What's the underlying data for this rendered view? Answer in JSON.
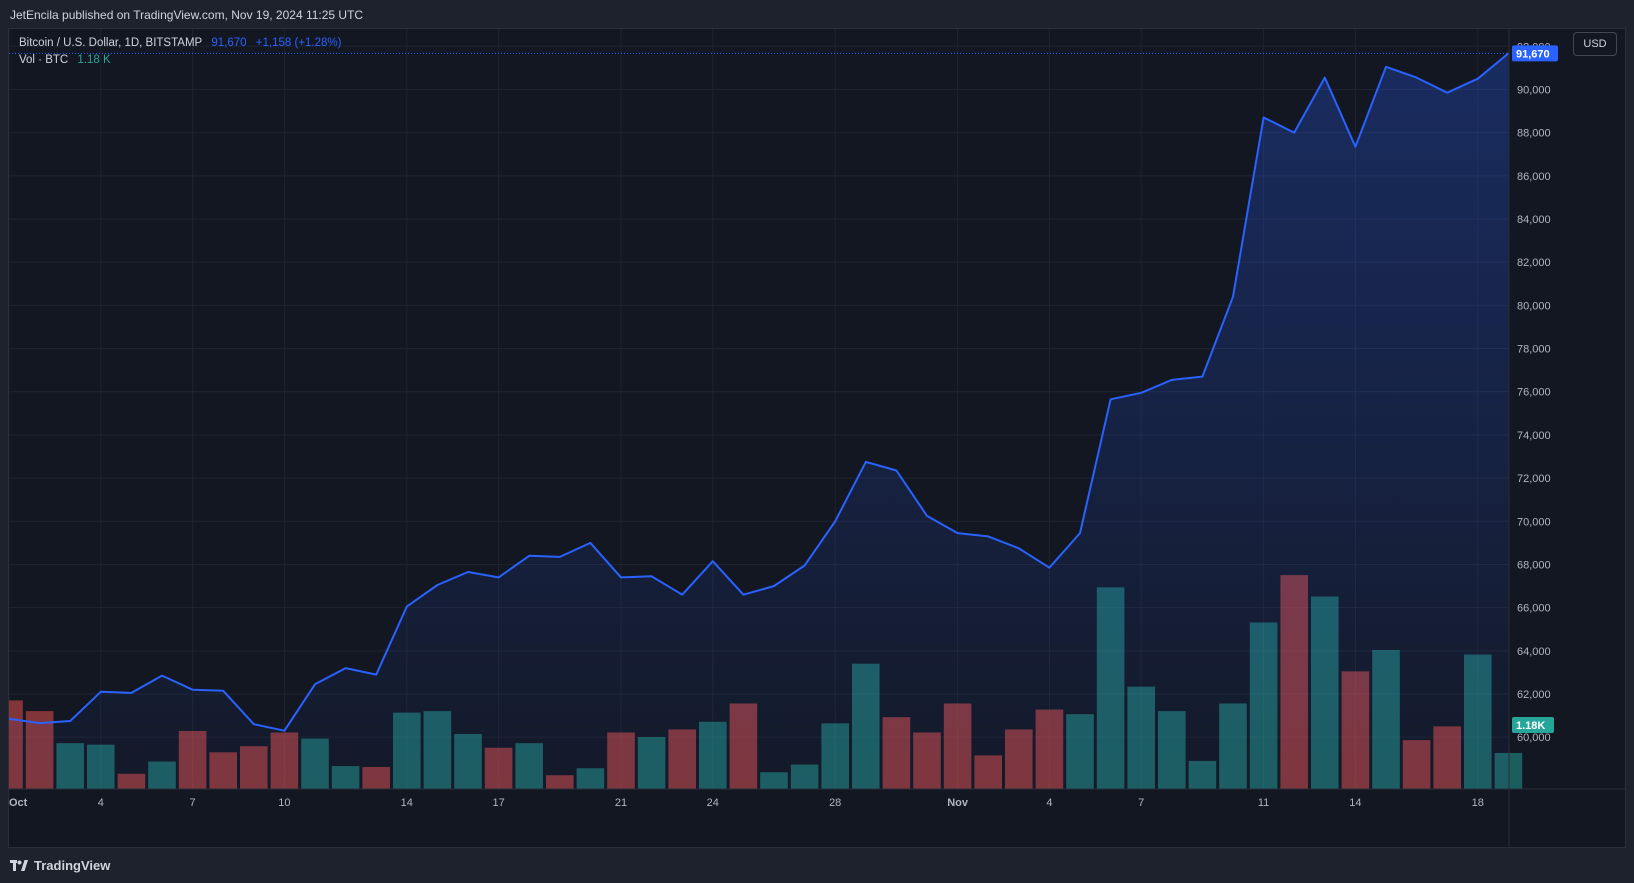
{
  "header": {
    "publisher": "JetEncila published on TradingView.com, Nov 19, 2024 11:25 UTC"
  },
  "legend": {
    "symbol": "Bitcoin / U.S. Dollar, 1D, BITSTAMP",
    "last": "91,670",
    "change": "+1,158 (+1.28%)",
    "vol_label": "Vol · BTC",
    "vol_value": "1.18 K"
  },
  "currency_button": "USD",
  "footer": {
    "brand": "TradingView"
  },
  "colors": {
    "line": "#2962ff",
    "up": "#26a69a",
    "down": "#ef5350",
    "background": "#131722"
  },
  "chart_data": [
    {
      "type": "area",
      "title": "Bitcoin / U.S. Dollar, 1D, BITSTAMP",
      "x": [
        "Oct 1",
        "Oct 2",
        "Oct 3",
        "Oct 4",
        "Oct 5",
        "Oct 6",
        "Oct 7",
        "Oct 8",
        "Oct 9",
        "Oct 10",
        "Oct 11",
        "Oct 12",
        "Oct 13",
        "Oct 14",
        "Oct 15",
        "Oct 16",
        "Oct 17",
        "Oct 18",
        "Oct 19",
        "Oct 20",
        "Oct 21",
        "Oct 22",
        "Oct 23",
        "Oct 24",
        "Oct 25",
        "Oct 26",
        "Oct 27",
        "Oct 28",
        "Oct 29",
        "Oct 30",
        "Oct 31",
        "Nov 1",
        "Nov 2",
        "Nov 3",
        "Nov 4",
        "Nov 5",
        "Nov 6",
        "Nov 7",
        "Nov 8",
        "Nov 9",
        "Nov 10",
        "Nov 11",
        "Nov 12",
        "Nov 13",
        "Nov 14",
        "Nov 15",
        "Nov 16",
        "Nov 17",
        "Nov 18",
        "Nov 19"
      ],
      "series": [
        {
          "values": [
            60850,
            60650,
            60750,
            62100,
            62050,
            62850,
            62200,
            62150,
            60600,
            60300,
            62450,
            63200,
            62900,
            66050,
            67050,
            67650,
            67400,
            68400,
            68350,
            69000,
            67400,
            67450,
            66600,
            68150,
            66600,
            67000,
            67950,
            70000,
            72750,
            72350,
            70250,
            69450,
            69300,
            68750,
            67850,
            69450,
            75650,
            75950,
            76550,
            76700,
            80400,
            88700,
            88000,
            90550,
            87350,
            91050,
            90550,
            89850,
            90500,
            91670
          ]
        }
      ],
      "xlabel": "",
      "ylabel": "",
      "ylim": [
        57600,
        92800
      ],
      "y_ticks": [
        "60,000",
        "62,000",
        "64,000",
        "66,000",
        "68,000",
        "70,000",
        "72,000",
        "74,000",
        "76,000",
        "78,000",
        "80,000",
        "82,000",
        "84,000",
        "86,000",
        "88,000",
        "90,000",
        "92,000"
      ],
      "x_tick_labels": [
        {
          "label": "Oct",
          "index": 0
        },
        {
          "label": "4",
          "index": 3
        },
        {
          "label": "7",
          "index": 6
        },
        {
          "label": "10",
          "index": 9
        },
        {
          "label": "14",
          "index": 13
        },
        {
          "label": "17",
          "index": 16
        },
        {
          "label": "21",
          "index": 20
        },
        {
          "label": "24",
          "index": 23
        },
        {
          "label": "28",
          "index": 27
        },
        {
          "label": "Nov",
          "index": 31
        },
        {
          "label": "4",
          "index": 34
        },
        {
          "label": "7",
          "index": 37
        },
        {
          "label": "11",
          "index": 41
        },
        {
          "label": "14",
          "index": 44
        },
        {
          "label": "18",
          "index": 48
        }
      ],
      "last_value_label": "91,670",
      "grid": true
    },
    {
      "type": "bar",
      "title": "Vol · BTC",
      "categories_ref": "same as price series x",
      "values": [
        2.9,
        2.55,
        1.5,
        1.45,
        0.5,
        0.9,
        1.9,
        1.2,
        1.4,
        1.85,
        1.65,
        0.75,
        0.72,
        2.5,
        2.55,
        1.8,
        1.35,
        1.5,
        0.45,
        0.68,
        1.85,
        1.7,
        1.95,
        2.2,
        2.8,
        0.55,
        0.8,
        2.15,
        4.1,
        2.35,
        1.85,
        2.8,
        1.1,
        1.95,
        2.6,
        2.45,
        6.6,
        3.35,
        2.55,
        0.92,
        2.8,
        5.45,
        7.0,
        6.3,
        3.85,
        4.55,
        1.6,
        2.05,
        4.4,
        1.18
      ],
      "direction": [
        "down",
        "down",
        "up",
        "up",
        "down",
        "up",
        "down",
        "down",
        "down",
        "down",
        "up",
        "up",
        "down",
        "up",
        "up",
        "up",
        "down",
        "up",
        "down",
        "up",
        "down",
        "up",
        "down",
        "up",
        "down",
        "up",
        "up",
        "up",
        "up",
        "down",
        "down",
        "down",
        "down",
        "down",
        "down",
        "up",
        "up",
        "up",
        "up",
        "up",
        "up",
        "up",
        "down",
        "up",
        "down",
        "up",
        "down",
        "down",
        "up",
        "up"
      ],
      "last_value_label": "1.18K",
      "ylim": [
        0,
        14
      ]
    }
  ]
}
